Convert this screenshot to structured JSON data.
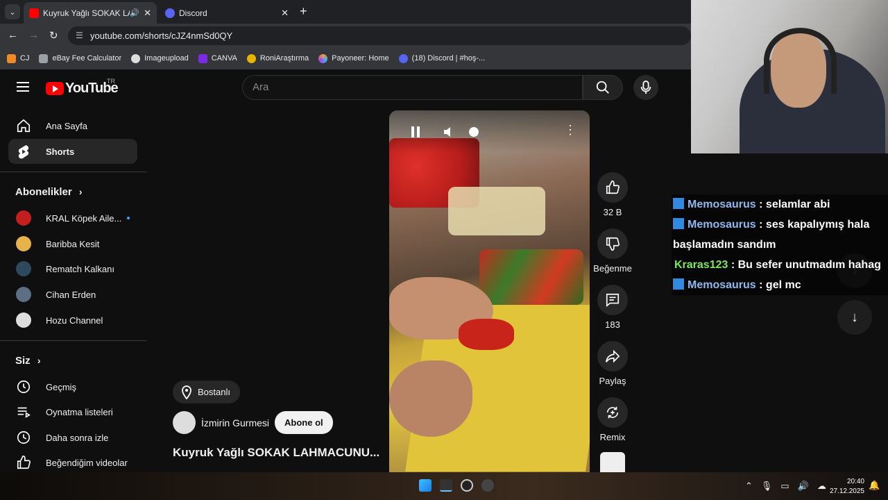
{
  "browser": {
    "tabs": [
      {
        "title": "Kuyruk Yağlı SOKAK LAHMACUNU...",
        "active": true
      },
      {
        "title": "Discord",
        "active": false
      }
    ],
    "url": "youtube.com/shorts/cJZ4nmSd0QY",
    "bookmarks": [
      "CJ",
      "eBay Fee Calculator",
      "Imageupload",
      "CANVA",
      "RoniAraştırma",
      "Payoneer: Home",
      "(18) Discord | #hoş-..."
    ]
  },
  "youtube": {
    "region": "TR",
    "logo_text": "YouTube",
    "search_placeholder": "Ara",
    "nav": {
      "home": "Ana Sayfa",
      "shorts": "Shorts"
    },
    "subscriptions_title": "Abonelikler",
    "subscriptions": [
      "KRAL Köpek Aile...",
      "Baribba Kesit",
      "Rematch Kalkanı",
      "Cihan Erden",
      "Hozu Channel"
    ],
    "you_title": "Siz",
    "you_items": [
      "Geçmiş",
      "Oynatma listeleri",
      "Daha sonra izle",
      "Beğendiğim videolar"
    ],
    "short": {
      "location": "Bostanlı",
      "channel": "İzmirin Gurmesi",
      "subscribe": "Abone ol",
      "title": "Kuyruk Yağlı SOKAK LAHMACUNU...",
      "likes": "32 B",
      "dislike": "Beğenme",
      "comments": "183",
      "share": "Paylaş",
      "remix": "Remix"
    }
  },
  "chat": [
    {
      "user": "Memosaurus",
      "msg": " : selamlar abi",
      "color": "#8fb8ef",
      "badge": true
    },
    {
      "user": "Memosaurus",
      "msg": " : ses kapalıymış hala başlamadın sandım",
      "color": "#8fb8ef",
      "badge": true
    },
    {
      "user": "Kraras123",
      "msg": " : Bu sefer unutmadım hahag",
      "color": "#79ea5b",
      "badge": false
    },
    {
      "user": "Memosaurus",
      "msg": " : gel mc",
      "color": "#8fb8ef",
      "badge": true
    }
  ],
  "taskbar": {
    "time": "20:40",
    "date": "27.12.2025"
  }
}
